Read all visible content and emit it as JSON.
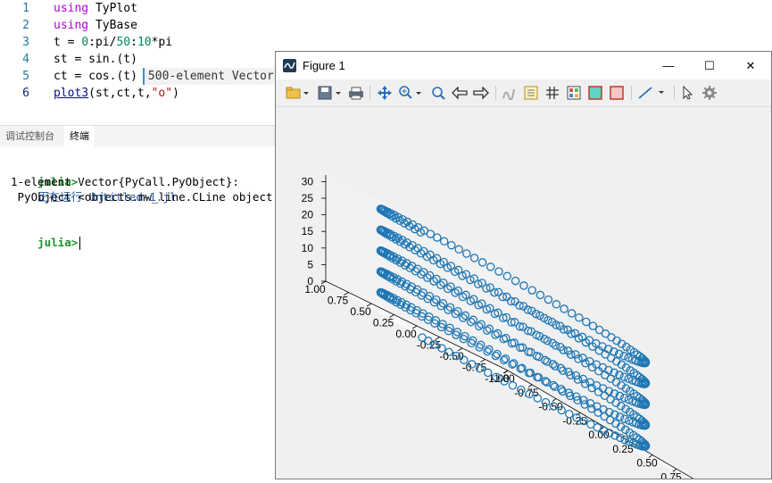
{
  "editor": {
    "lines": [
      {
        "n": "1",
        "parts": [
          {
            "t": "using",
            "c": "kw"
          },
          {
            "t": " TyPlot",
            "c": ""
          }
        ]
      },
      {
        "n": "2",
        "parts": [
          {
            "t": "using",
            "c": "kw"
          },
          {
            "t": " TyBase",
            "c": ""
          }
        ]
      },
      {
        "n": "3",
        "parts": [
          {
            "t": "t = ",
            "c": ""
          },
          {
            "t": "0",
            "c": "num"
          },
          {
            "t": ":pi/",
            "c": ""
          },
          {
            "t": "50",
            "c": "num"
          },
          {
            "t": ":",
            "c": ""
          },
          {
            "t": "10",
            "c": "num"
          },
          {
            "t": "*pi",
            "c": ""
          }
        ]
      },
      {
        "n": "4",
        "parts": [
          {
            "t": "st = sin.(t)",
            "c": ""
          }
        ]
      },
      {
        "n": "5",
        "parts": [
          {
            "t": "ct = cos.(t)",
            "c": ""
          }
        ],
        "inline_result": "500-element Vector"
      },
      {
        "n": "6",
        "parts": [
          {
            "t": "plot3",
            "c": "fn-link"
          },
          {
            "t": "(st,ct,t,",
            "c": ""
          },
          {
            "t": "\"o\"",
            "c": "str"
          },
          {
            "t": ")",
            "c": ""
          }
        ],
        "active": true
      }
    ]
  },
  "terminal": {
    "tabs": [
      "调试控制台",
      "终端"
    ],
    "active_tab": "终端",
    "line1_prompt": "julia>",
    "line1_running": "正在运行 Untitled-1.jl",
    "line2": "1-element Vector{PyCall.PyObject}:",
    "line3": " PyObject <objects.mw_line.CLine object at",
    "line4_prompt": "julia>"
  },
  "figure": {
    "title": "Figure 1",
    "window_buttons": [
      "—",
      "☐",
      "✕"
    ],
    "toolbar_icons": [
      "open-folder-icon",
      "save-icon",
      "print-icon",
      "pan-icon",
      "zoom-in-icon",
      "zoom-fit-icon",
      "back-icon",
      "forward-icon",
      "brush-icon",
      "insert-legend-icon",
      "grid-icon",
      "colorbar-icon",
      "fill-icon",
      "box-icon",
      "line-style-icon",
      "pointer-icon",
      "settings-icon"
    ]
  },
  "chart_data": {
    "type": "scatter",
    "projection": "3d",
    "marker": "o",
    "color": "#1f77b4",
    "x_expr": "sin(t)",
    "y_expr": "cos(t)",
    "z_expr": "t",
    "t_range": [
      0,
      31.4159
    ],
    "t_step": 0.0628,
    "xlim": [
      -1,
      1
    ],
    "ylim": [
      -1,
      1
    ],
    "zlim": [
      0,
      32
    ],
    "x_ticks": [
      "-1.00",
      "-0.75",
      "-0.50",
      "-0.25",
      "0.00",
      "0.25",
      "0.50",
      "0.75",
      "1.00"
    ],
    "y_ticks": [
      "1.00",
      "0.75",
      "0.50",
      "0.25",
      "0.00",
      "-0.25",
      "-0.50",
      "-0.75",
      "-1.00"
    ],
    "z_ticks": [
      "0",
      "5",
      "10",
      "15",
      "20",
      "25",
      "30"
    ],
    "grid": false,
    "title": "",
    "xlabel": "",
    "ylabel": "",
    "zlabel": ""
  },
  "colors": {
    "accent": "#1f77b4",
    "prompt": "#1f8f2f"
  }
}
